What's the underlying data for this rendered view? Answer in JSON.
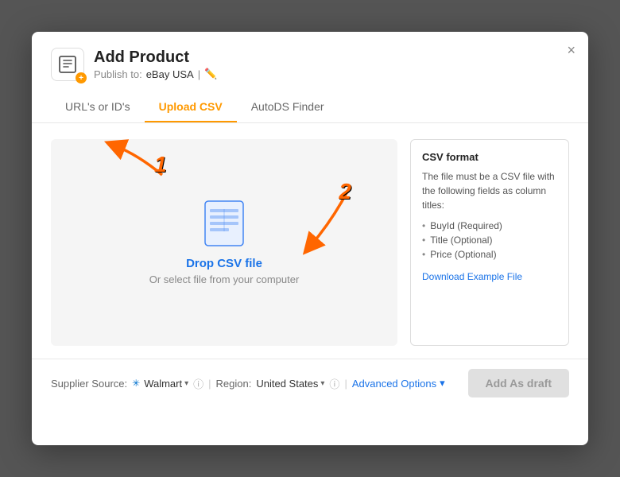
{
  "modal": {
    "close_label": "×",
    "title": "Add Product",
    "publish_label": "Publish to:",
    "publish_value": "eBay USA",
    "publish_separator": "|"
  },
  "tabs": [
    {
      "id": "urls",
      "label": "URL's or ID's",
      "active": false
    },
    {
      "id": "upload-csv",
      "label": "Upload CSV",
      "active": true
    },
    {
      "id": "autods-finder",
      "label": "AutoDS Finder",
      "active": false
    }
  ],
  "upload": {
    "drop_label": "Drop CSV file",
    "or_text": "Or select file from your computer",
    "annotation_1": "1",
    "annotation_2": "2"
  },
  "csv_info": {
    "title": "CSV format",
    "description": "The file must be a CSV file with the following fields as column titles:",
    "fields": [
      "BuyId (Required)",
      "Title (Optional)",
      "Price (Optional)"
    ],
    "download_label": "Download Example File"
  },
  "footer": {
    "supplier_label": "Supplier Source:",
    "supplier_value": "Walmart",
    "region_label": "Region:",
    "region_value": "United States",
    "advanced_options_label": "Advanced Options",
    "add_draft_label": "Add As draft"
  }
}
